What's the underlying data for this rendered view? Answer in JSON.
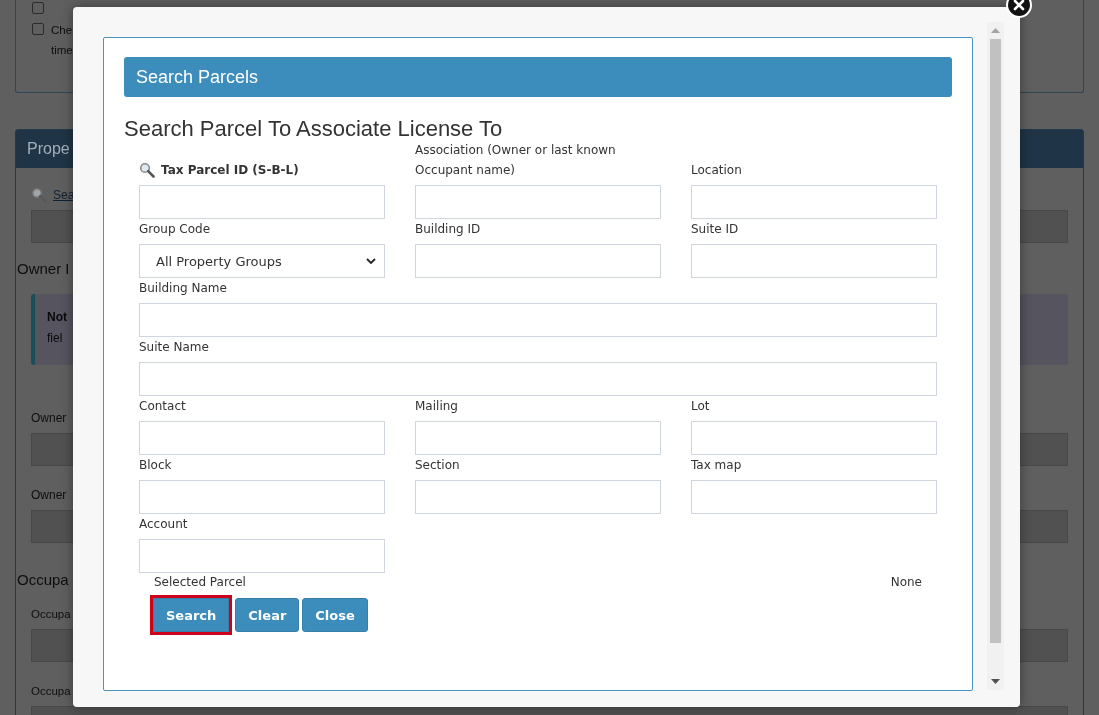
{
  "background": {
    "checkboxes": [
      {
        "checked": false
      },
      {
        "lines": [
          "Che",
          "time"
        ],
        "checked": false
      }
    ],
    "panel_title": "Prope",
    "search_link": "Sea",
    "owner_heading": "Owner I",
    "note": {
      "title": "Not",
      "text": "fiel"
    },
    "owner_fields": [
      "Owner",
      "Owner"
    ],
    "occupant_heading": "Occupa",
    "occupant_fields": [
      "Occupa",
      "Occupa"
    ]
  },
  "dialog": {
    "header": "Search Parcels",
    "title": "Search Parcel To Associate License To",
    "fields": [
      {
        "label": "Tax Parcel ID (S-B-L)",
        "kind": "search"
      },
      {
        "label": "Association (Owner or last known Occupant name)",
        "kind": "text"
      },
      {
        "label": "Location",
        "kind": "text"
      },
      {
        "label": "Group Code",
        "kind": "select",
        "value": "All Property Groups"
      },
      {
        "label": "Building ID",
        "kind": "text"
      },
      {
        "label": "Suite ID",
        "kind": "text"
      },
      {
        "label": "Building Name",
        "kind": "wide"
      },
      {
        "label": "Suite Name",
        "kind": "wide"
      },
      {
        "label": "Contact",
        "kind": "text"
      },
      {
        "label": "Mailing",
        "kind": "text"
      },
      {
        "label": "Lot",
        "kind": "text"
      },
      {
        "label": "Block",
        "kind": "text"
      },
      {
        "label": "Section",
        "kind": "text"
      },
      {
        "label": "Tax map",
        "kind": "text"
      },
      {
        "label": "Account",
        "kind": "text"
      }
    ],
    "selected_label": "Selected Parcel",
    "selected_value": "None",
    "buttons": [
      {
        "label": "Search",
        "focused": true
      },
      {
        "label": "Clear",
        "focused": false
      },
      {
        "label": "Close",
        "focused": false
      }
    ]
  }
}
